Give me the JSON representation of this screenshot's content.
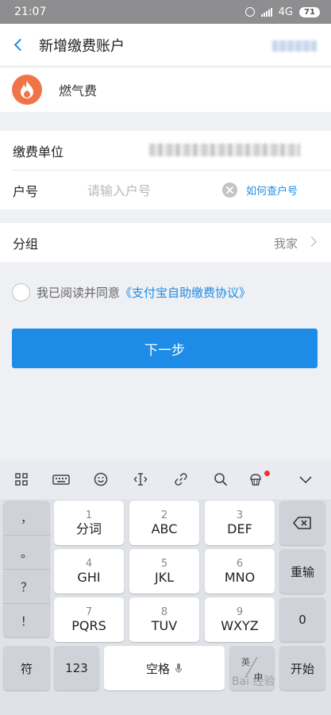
{
  "status_bar": {
    "time": "21:07",
    "network": "4G",
    "battery": "71",
    "icons": [
      "alarm-icon",
      "signal-icon",
      "battery-icon"
    ]
  },
  "nav": {
    "title": "新增缴费账户",
    "back_icon": "chevron-left-icon"
  },
  "payment_type": {
    "label": "燃气费",
    "icon": "flame-icon",
    "icon_color": "#f07448"
  },
  "form": {
    "unit_label": "缴费单位",
    "account_label": "户号",
    "account_placeholder": "请输入户号",
    "account_value": "",
    "help_link": "如何查户号"
  },
  "group": {
    "label": "分组",
    "value": "我家"
  },
  "agreement": {
    "text": "我已阅读并同意",
    "link": "《支付宝自助缴费协议》",
    "checked": false
  },
  "next_button": "下一步",
  "keyboard": {
    "toolbar_icons": [
      "grid-icon",
      "keyboard-icon",
      "emoji-icon",
      "cursor-icon",
      "link-icon",
      "search-icon",
      "cupcake-icon",
      "chevron-down-icon"
    ],
    "symbols": [
      "，",
      "。",
      "？",
      "！"
    ],
    "keys": [
      {
        "num": "1",
        "letters": "分词"
      },
      {
        "num": "2",
        "letters": "ABC"
      },
      {
        "num": "3",
        "letters": "DEF"
      },
      {
        "num": "4",
        "letters": "GHI"
      },
      {
        "num": "5",
        "letters": "JKL"
      },
      {
        "num": "6",
        "letters": "MNO"
      },
      {
        "num": "7",
        "letters": "PQRS"
      },
      {
        "num": "8",
        "letters": "TUV"
      },
      {
        "num": "9",
        "letters": "WXYZ"
      }
    ],
    "right_keys": {
      "reenter": "重输",
      "zero": "0",
      "go": "开始"
    },
    "bottom": {
      "symbol": "符",
      "numbers": "123",
      "space": "空格",
      "lang_top": "英",
      "lang_bottom": "中"
    },
    "accent_dot_color": "#f0312e"
  },
  "watermark": "Bai 经验"
}
